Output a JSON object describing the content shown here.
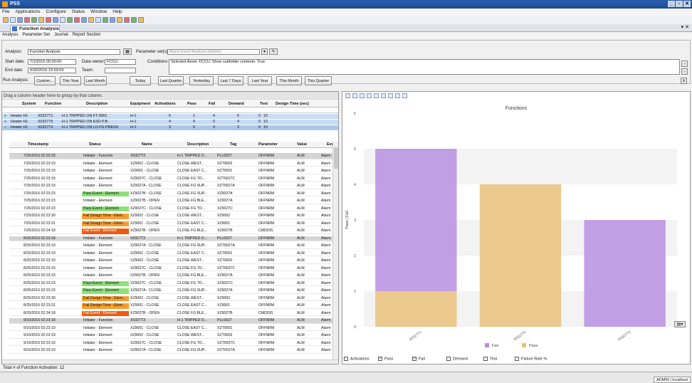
{
  "app": {
    "title": "PSS"
  },
  "window_buttons": [
    "_",
    "▫",
    "✕"
  ],
  "menus": [
    "File",
    "Applications",
    "Configure",
    "Status",
    "Window",
    "Help"
  ],
  "doc_tab": {
    "label": "Function Analysis",
    "close": "▾ ✕"
  },
  "submenus": [
    "Analysis",
    "Parameter Set",
    "Journal",
    "Report Section"
  ],
  "params": {
    "analysis_label": "Analysis:",
    "analysis_value": "Function Analysis",
    "paramset_label": "Parameter set(s):",
    "paramset_value": "Alarm Event Analysis (Admin)",
    "start_label": "Start date:",
    "start_value": "7/1/2016 00:00:00",
    "owner_label": "Data owner:",
    "owner_value": "FCCU",
    "conditions_label": "Conditions:",
    "conditions_value": "Selected Asset: FCCU; Show subfolder contents: True",
    "end_label": "End date:",
    "end_value": "9/30/2016 23:59:59",
    "team_label": "Team:",
    "team_value": ""
  },
  "run": {
    "label": "Run Analysis:",
    "buttons": [
      "Custom...",
      "This Year",
      "Last Month",
      "Today",
      "Last Quarter",
      "Yesterday",
      "Last 7 Days",
      "Last Year",
      "This Month",
      "This Quarter"
    ]
  },
  "grid": {
    "group_hint": "Drag a column header here to group by that column.",
    "group_headers": [
      "System",
      "Function",
      "Description",
      "Equipment",
      "Activations",
      "Pass",
      "Fail",
      "Demand",
      "Test",
      "Design Time (sec)"
    ],
    "groups": [
      {
        "system": "Heater H1",
        "function": "X0327T1",
        "desc": "H-1 TRIPPED ON FT-0001",
        "equip": "H-1",
        "act": "5",
        "pass": "1",
        "fail": "4",
        "demand": "5",
        "test": "0",
        "dt": "10"
      },
      {
        "system": "Heater H1",
        "function": "X0327T5",
        "desc": "H-1 TRIPPED ON ESD P.B.",
        "equip": "H-1",
        "act": "4",
        "pass": "4",
        "fail": "0",
        "demand": "4",
        "test": "0",
        "dt": "10"
      },
      {
        "system": "Heater H1",
        "function": "X0327T3",
        "desc": "H-1 TRIPPED ON LO FG PRESS",
        "equip": "H-1",
        "act": "3",
        "pass": "0",
        "fail": "3",
        "demand": "3",
        "test": "0",
        "dt": "10"
      }
    ],
    "child_headers": [
      "Timestamp",
      "Status",
      "Name",
      "Description",
      "Tag",
      "Parameter",
      "Value",
      "Eve"
    ],
    "rows": [
      {
        "ts": "7/25/2016 02:23:18",
        "status": "Initiator - Function",
        "cls": "",
        "name": "X0327T3",
        "desc": "H-1 TRIPPED O...",
        "tag": "PLL0027",
        "param": "OFFNRM",
        "value": "ALM",
        "ev": "Alarm",
        "hl": true
      },
      {
        "ts": "7/25/2016 02:23:19",
        "status": "Initiator - Element",
        "cls": "",
        "name": "XZ9002 - CLOSE",
        "desc": "CLOSE WEST...",
        "tag": "XZT9002",
        "param": "OFFNRM",
        "value": "ALM",
        "ev": "Alarm"
      },
      {
        "ts": "7/25/2016 02:23:19",
        "status": "Initiator - Element",
        "cls": "",
        "name": "XZ9001 - CLOSE",
        "desc": "CLOSE EAST C...",
        "tag": "XZT9001",
        "param": "OFFNRM",
        "value": "ALM",
        "ev": "Alarm"
      },
      {
        "ts": "7/25/2016 02:23:19",
        "status": "Initiator - Element",
        "cls": "",
        "name": "XZ9027C - CLOSE",
        "desc": "CLOSE FG TO...",
        "tag": "XZT9027C",
        "param": "OFFNRM",
        "value": "ALM",
        "ev": "Alarm"
      },
      {
        "ts": "7/25/2016 02:23:19",
        "status": "Initiator - Element",
        "cls": "",
        "name": "XZ9027A - CLOSE",
        "desc": "CLOSE FG SUP...",
        "tag": "XZT9027A",
        "param": "OFFNRM",
        "value": "ALM",
        "ev": "Alarm"
      },
      {
        "ts": "7/25/2016 02:23:23",
        "status": "Pass Event - Element",
        "cls": "pass",
        "name": "XZ9027B - CLOSE",
        "desc": "CLOSE FG SUP...",
        "tag": "XZ9027A",
        "param": "OFFNRM",
        "value": "ALM",
        "ev": "Alarm"
      },
      {
        "ts": "7/25/2016 02:23:23",
        "status": "Initiator - Element",
        "cls": "",
        "name": "XZ9027B - OPEN",
        "desc": "CLOSE FG BLE...",
        "tag": "XZ9027A",
        "param": "OFFNRM",
        "value": "ALM",
        "ev": "Alarm"
      },
      {
        "ts": "7/25/2016 02:23:23",
        "status": "Pass Event - Element",
        "cls": "pass",
        "name": "XZ9027C - CLOSE",
        "desc": "CLOSE FG TO...",
        "tag": "XZ9027C",
        "param": "OFFNRM",
        "value": "ALM",
        "ev": "Alarm"
      },
      {
        "ts": "7/25/2016 02:23:30",
        "status": "Fail Design Time - Elem...",
        "cls": "fdt",
        "name": "XZ9002 - CLOSE",
        "desc": "CLOSE WEST...",
        "tag": "XZ9002",
        "param": "OFFNRM",
        "value": "ALM",
        "ev": "Alarm"
      },
      {
        "ts": "7/25/2016 02:23:31",
        "status": "Fail Design Time - Elem...",
        "cls": "fdt",
        "name": "XZ9001 - CLOSE",
        "desc": "CLOSE EAST C...",
        "tag": "XZ9001",
        "param": "OFFNRM",
        "value": "ALM",
        "ev": "Alarm"
      },
      {
        "ts": "7/25/2016 02:24:18",
        "status": "Fail Event - Element",
        "cls": "fail",
        "name": "XZ9027B - OPEN",
        "desc": "CLOSE FG BLE...",
        "tag": "XZ9027B",
        "param": "CMDDIS",
        "value": "ALM",
        "ev": "Alarm"
      },
      {
        "ts": "8/25/2016 02:23:18",
        "status": "Initiator - Function",
        "cls": "",
        "name": "X0327T3",
        "desc": "H-1 TRIPPED O...",
        "tag": "PLL0027",
        "param": "OFFNRM",
        "value": "ALM",
        "ev": "Alarm",
        "hl": true
      },
      {
        "ts": "8/25/2016 02:23:19",
        "status": "Initiator - Element",
        "cls": "",
        "name": "XZ9027A - CLOSE",
        "desc": "CLOSE FG SUP...",
        "tag": "XZT9027A",
        "param": "OFFNRM",
        "value": "ALM",
        "ev": "Alarm"
      },
      {
        "ts": "8/25/2016 02:23:19",
        "status": "Initiator - Element",
        "cls": "",
        "name": "XZ9001 - CLOSE",
        "desc": "CLOSE EAST C...",
        "tag": "XZT9001",
        "param": "OFFNRM",
        "value": "ALM",
        "ev": "Alarm"
      },
      {
        "ts": "8/25/2016 02:23:19",
        "status": "Initiator - Element",
        "cls": "",
        "name": "XZ9002 - CLOSE",
        "desc": "CLOSE WEST...",
        "tag": "XZT9002",
        "param": "OFFNRM",
        "value": "ALM",
        "ev": "Alarm"
      },
      {
        "ts": "8/25/2016 02:23:19",
        "status": "Initiator - Element",
        "cls": "",
        "name": "XZ9027C - CLOSE",
        "desc": "CLOSE FG TO...",
        "tag": "XZT9027C",
        "param": "OFFNRM",
        "value": "ALM",
        "ev": "Alarm"
      },
      {
        "ts": "8/25/2016 02:23:23",
        "status": "Initiator - Element",
        "cls": "",
        "name": "XZ9027B - OPEN",
        "desc": "CLOSE FG BLE...",
        "tag": "XZ9027A",
        "param": "OFFNRM",
        "value": "ALM",
        "ev": "Alarm"
      },
      {
        "ts": "8/25/2016 02:23:23",
        "status": "Pass Event - Element",
        "cls": "pass",
        "name": "XZ9027C - CLOSE",
        "desc": "CLOSE FG TO...",
        "tag": "XZ9027C",
        "param": "OFFNRM",
        "value": "ALM",
        "ev": "Alarm"
      },
      {
        "ts": "8/25/2016 02:23:23",
        "status": "Pass Event - Element",
        "cls": "pass",
        "name": "XZ9027A - CLOSE",
        "desc": "CLOSE FG SUP...",
        "tag": "XZ9027A",
        "param": "OFFNRM",
        "value": "ALM",
        "ev": "Alarm"
      },
      {
        "ts": "8/25/2016 02:23:30",
        "status": "Fail Design Time - Elem...",
        "cls": "fdt",
        "name": "XZ9002 - CLOSE",
        "desc": "CLOSE WEST...",
        "tag": "XZ9002",
        "param": "OFFNRM",
        "value": "ALM",
        "ev": "Alarm"
      },
      {
        "ts": "8/25/2016 02:23:31",
        "status": "Fail Design Time - Elem...",
        "cls": "fdt",
        "name": "XZ9001 - CLOSE",
        "desc": "CLOSE EAST C...",
        "tag": "XZ9001",
        "param": "OFFNRM",
        "value": "ALM",
        "ev": "Alarm"
      },
      {
        "ts": "8/25/2016 02:24:18",
        "status": "Fail Event - Element",
        "cls": "fail",
        "name": "XZ9027B - OPEN",
        "desc": "CLOSE FG BLE...",
        "tag": "XZ9027B",
        "param": "CMDDIS",
        "value": "ALM",
        "ev": "Alarm"
      },
      {
        "ts": "9/15/2016 02:23:18",
        "status": "Initiator - Function",
        "cls": "",
        "name": "X0327T3",
        "desc": "H-1 TRIPPED O...",
        "tag": "PLL0027",
        "param": "OFFNRM",
        "value": "ALM",
        "ev": "Alarm",
        "hl": true
      },
      {
        "ts": "9/15/2016 02:23:19",
        "status": "Initiator - Element",
        "cls": "",
        "name": "XZ9001 - CLOSE",
        "desc": "CLOSE EAST C...",
        "tag": "XZT9001",
        "param": "OFFNRM",
        "value": "ALM",
        "ev": "Alarm"
      },
      {
        "ts": "9/15/2016 02:23:19",
        "status": "Initiator - Element",
        "cls": "",
        "name": "XZ9002 - CLOSE",
        "desc": "CLOSE WEST...",
        "tag": "XZT9002",
        "param": "OFFNRM",
        "value": "ALM",
        "ev": "Alarm"
      },
      {
        "ts": "9/15/2016 02:23:19",
        "status": "Initiator - Element",
        "cls": "",
        "name": "XZ9027C - CLOSE",
        "desc": "CLOSE FG TO...",
        "tag": "XZT9027C",
        "param": "OFFNRM",
        "value": "ALM",
        "ev": "Alarm"
      },
      {
        "ts": "9/15/2016 02:23:19",
        "status": "Initiator - Element",
        "cls": "",
        "name": "XZ9027A - CLOSE",
        "desc": "CLOSE FG SUP...",
        "tag": "XZT9027A",
        "param": "OFFNRM",
        "value": "ALM",
        "ev": "Alarm"
      }
    ],
    "total": "Total # of Function Activation: 12"
  },
  "checkboxes": [
    {
      "label": "Activations",
      "checked": false
    },
    {
      "label": "Pass",
      "checked": true
    },
    {
      "label": "Fail",
      "checked": true
    },
    {
      "label": "Demand",
      "checked": false
    },
    {
      "label": "Test",
      "checked": false
    },
    {
      "label": "Failure Rate %",
      "checked": false
    }
  ],
  "colors": {
    "pass": "#e9bf7a",
    "fail": "#b98ee0",
    "pass_event": "#8fe07b",
    "fail_design": "#f7a030",
    "fail_event": "#f05a10"
  },
  "chart_data": {
    "type": "bar",
    "title": "Functions",
    "ylabel": "Pass | Fail",
    "xlabel": "",
    "categories": [
      "X0327T1",
      "X0327T5",
      "X0327T3"
    ],
    "series": [
      {
        "name": "Fail",
        "color": "#b98ee0",
        "values": [
          4,
          0,
          3
        ]
      },
      {
        "name": "Pass",
        "color": "#e9bf7a",
        "values": [
          1,
          4,
          0
        ]
      }
    ],
    "stacked": true,
    "ylim": [
      0,
      6
    ],
    "yticks": [
      0,
      1,
      2,
      3,
      4,
      5,
      6
    ],
    "legend": "bottom",
    "grid": true
  },
  "statusbar": {
    "user": "ADMIN | localhost"
  }
}
